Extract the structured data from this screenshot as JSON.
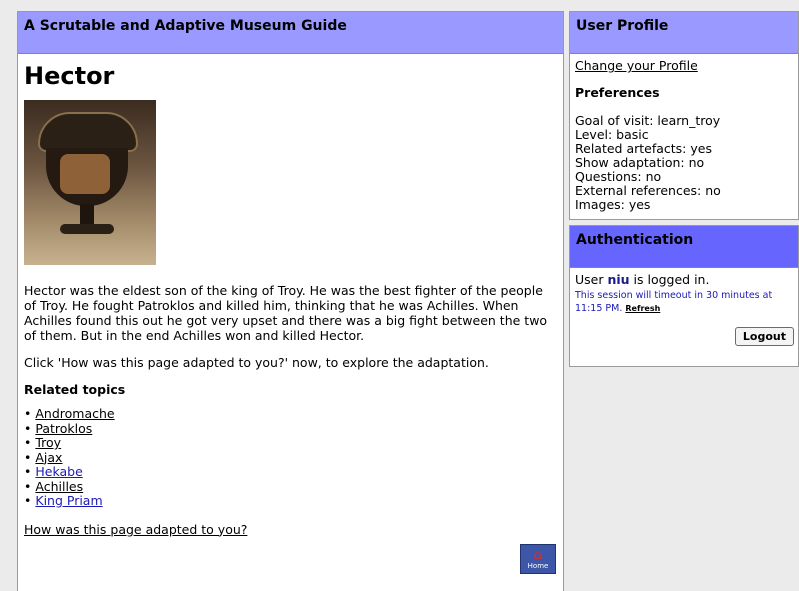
{
  "main": {
    "header": "A Scrutable and Adaptive Museum Guide",
    "title": "Hector",
    "description": "Hector was the eldest son of the king of Troy. He was the best fighter of the people of Troy. He fought Patroklos and killed him, thinking that he was Achilles. When Achilles found this out he got very upset and there was a big fight between the two of them. But in the end Achilles won and killed Hector.",
    "hint": "Click 'How was this page adapted to you?' now, to explore the adaptation.",
    "related_title": "Related topics",
    "related": [
      "Andromache",
      "Patroklos",
      "Troy",
      "Ajax",
      "Hekabe",
      "Achilles",
      "King Priam"
    ],
    "adapted_link": "How was this page adapted to you?",
    "home_label": "Home"
  },
  "profile": {
    "header": "User Profile",
    "change_link": "Change your Profile",
    "prefs_title": "Preferences",
    "prefs": [
      "Goal of visit: learn_troy",
      "Level: basic",
      "Related artefacts: yes",
      "Show adaptation: no",
      "Questions: no",
      "External references: no",
      "Images: yes"
    ]
  },
  "auth": {
    "header": "Authentication",
    "user_prefix": "User ",
    "username": "niu",
    "user_suffix": " is logged in.",
    "session_text": "This session will timeout in 30 minutes at 11:15 PM.",
    "refresh_label": "Refresh",
    "logout_label": "Logout"
  },
  "colors": {
    "header_bg": "#9999ff",
    "auth_header_bg": "#6666ff",
    "link_blue": "#1a1ab5"
  }
}
